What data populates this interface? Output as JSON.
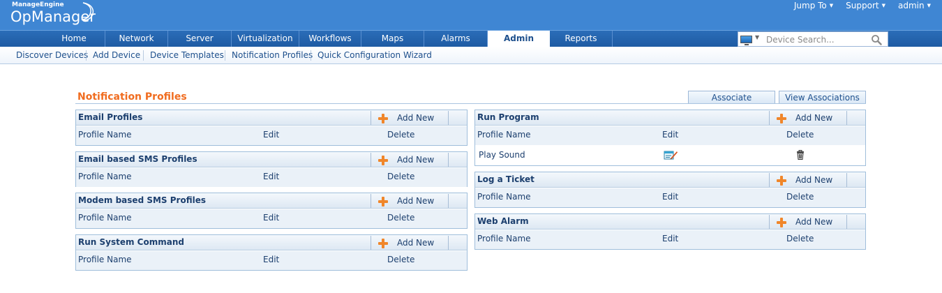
{
  "header": {
    "brand_small": "ManageEngine",
    "brand_big": "OpManager",
    "top_links": [
      "Jump To",
      "Support",
      "admin"
    ]
  },
  "nav": {
    "tabs": [
      "Home",
      "Network",
      "Server",
      "Virtualization",
      "Workflows",
      "Maps",
      "Alarms",
      "Admin",
      "Reports"
    ],
    "active": "Admin",
    "search_placeholder": "Device Search..."
  },
  "subnav": {
    "items": [
      "Discover Devices",
      "Add Device",
      "Device Templates",
      "Notification Profiles",
      "Quick Configuration Wizard"
    ]
  },
  "page": {
    "title": "Notification Profiles",
    "associate_label": "Associate",
    "view_associations_label": "View Associations"
  },
  "columns": {
    "profile_name": "Profile Name",
    "edit": "Edit",
    "delete": "Delete"
  },
  "add_new_label": "Add New",
  "panels_left": [
    {
      "title": "Email Profiles"
    },
    {
      "title": "Email based SMS Profiles"
    },
    {
      "title": "Modem based SMS Profiles"
    },
    {
      "title": "Run System Command"
    }
  ],
  "panels_right": [
    {
      "title": "Run Program",
      "rows": [
        {
          "name": "Play Sound"
        }
      ]
    },
    {
      "title": "Log a Ticket"
    },
    {
      "title": "Web Alarm"
    }
  ],
  "colors": {
    "header_blue": "#3f86d3",
    "nav_blue": "#1e5ba3",
    "title_orange": "#f06c1f",
    "add_plus_orange": "#f0862a",
    "text_navy": "#1c3f6e"
  },
  "icons": {
    "search": "magnifier-icon",
    "device_type": "monitor-icon",
    "add": "plus-icon",
    "edit": "edit-pencil-icon",
    "delete": "trash-icon"
  }
}
